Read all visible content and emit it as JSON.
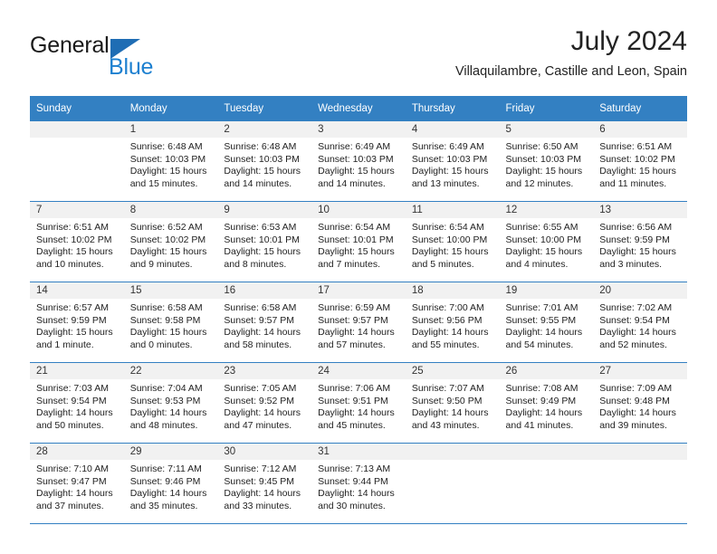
{
  "brand": {
    "name_part1": "General",
    "name_part2": "Blue",
    "triangle_color": "#1f6db4",
    "blue_color": "#1d80d0"
  },
  "header": {
    "title": "July 2024",
    "subtitle": "Villaquilambre, Castille and Leon, Spain"
  },
  "theme": {
    "header_bg": "#3380c2",
    "daynum_bg": "#f1f1f1",
    "grid_line": "#3380c2"
  },
  "weekday_headers": [
    "Sunday",
    "Monday",
    "Tuesday",
    "Wednesday",
    "Thursday",
    "Friday",
    "Saturday"
  ],
  "weeks": [
    [
      {
        "day": "",
        "sunrise": "",
        "sunset": "",
        "daylight_l1": "",
        "daylight_l2": ""
      },
      {
        "day": "1",
        "sunrise": "Sunrise: 6:48 AM",
        "sunset": "Sunset: 10:03 PM",
        "daylight_l1": "Daylight: 15 hours",
        "daylight_l2": "and 15 minutes."
      },
      {
        "day": "2",
        "sunrise": "Sunrise: 6:48 AM",
        "sunset": "Sunset: 10:03 PM",
        "daylight_l1": "Daylight: 15 hours",
        "daylight_l2": "and 14 minutes."
      },
      {
        "day": "3",
        "sunrise": "Sunrise: 6:49 AM",
        "sunset": "Sunset: 10:03 PM",
        "daylight_l1": "Daylight: 15 hours",
        "daylight_l2": "and 14 minutes."
      },
      {
        "day": "4",
        "sunrise": "Sunrise: 6:49 AM",
        "sunset": "Sunset: 10:03 PM",
        "daylight_l1": "Daylight: 15 hours",
        "daylight_l2": "and 13 minutes."
      },
      {
        "day": "5",
        "sunrise": "Sunrise: 6:50 AM",
        "sunset": "Sunset: 10:03 PM",
        "daylight_l1": "Daylight: 15 hours",
        "daylight_l2": "and 12 minutes."
      },
      {
        "day": "6",
        "sunrise": "Sunrise: 6:51 AM",
        "sunset": "Sunset: 10:02 PM",
        "daylight_l1": "Daylight: 15 hours",
        "daylight_l2": "and 11 minutes."
      }
    ],
    [
      {
        "day": "7",
        "sunrise": "Sunrise: 6:51 AM",
        "sunset": "Sunset: 10:02 PM",
        "daylight_l1": "Daylight: 15 hours",
        "daylight_l2": "and 10 minutes."
      },
      {
        "day": "8",
        "sunrise": "Sunrise: 6:52 AM",
        "sunset": "Sunset: 10:02 PM",
        "daylight_l1": "Daylight: 15 hours",
        "daylight_l2": "and 9 minutes."
      },
      {
        "day": "9",
        "sunrise": "Sunrise: 6:53 AM",
        "sunset": "Sunset: 10:01 PM",
        "daylight_l1": "Daylight: 15 hours",
        "daylight_l2": "and 8 minutes."
      },
      {
        "day": "10",
        "sunrise": "Sunrise: 6:54 AM",
        "sunset": "Sunset: 10:01 PM",
        "daylight_l1": "Daylight: 15 hours",
        "daylight_l2": "and 7 minutes."
      },
      {
        "day": "11",
        "sunrise": "Sunrise: 6:54 AM",
        "sunset": "Sunset: 10:00 PM",
        "daylight_l1": "Daylight: 15 hours",
        "daylight_l2": "and 5 minutes."
      },
      {
        "day": "12",
        "sunrise": "Sunrise: 6:55 AM",
        "sunset": "Sunset: 10:00 PM",
        "daylight_l1": "Daylight: 15 hours",
        "daylight_l2": "and 4 minutes."
      },
      {
        "day": "13",
        "sunrise": "Sunrise: 6:56 AM",
        "sunset": "Sunset: 9:59 PM",
        "daylight_l1": "Daylight: 15 hours",
        "daylight_l2": "and 3 minutes."
      }
    ],
    [
      {
        "day": "14",
        "sunrise": "Sunrise: 6:57 AM",
        "sunset": "Sunset: 9:59 PM",
        "daylight_l1": "Daylight: 15 hours",
        "daylight_l2": "and 1 minute."
      },
      {
        "day": "15",
        "sunrise": "Sunrise: 6:58 AM",
        "sunset": "Sunset: 9:58 PM",
        "daylight_l1": "Daylight: 15 hours",
        "daylight_l2": "and 0 minutes."
      },
      {
        "day": "16",
        "sunrise": "Sunrise: 6:58 AM",
        "sunset": "Sunset: 9:57 PM",
        "daylight_l1": "Daylight: 14 hours",
        "daylight_l2": "and 58 minutes."
      },
      {
        "day": "17",
        "sunrise": "Sunrise: 6:59 AM",
        "sunset": "Sunset: 9:57 PM",
        "daylight_l1": "Daylight: 14 hours",
        "daylight_l2": "and 57 minutes."
      },
      {
        "day": "18",
        "sunrise": "Sunrise: 7:00 AM",
        "sunset": "Sunset: 9:56 PM",
        "daylight_l1": "Daylight: 14 hours",
        "daylight_l2": "and 55 minutes."
      },
      {
        "day": "19",
        "sunrise": "Sunrise: 7:01 AM",
        "sunset": "Sunset: 9:55 PM",
        "daylight_l1": "Daylight: 14 hours",
        "daylight_l2": "and 54 minutes."
      },
      {
        "day": "20",
        "sunrise": "Sunrise: 7:02 AM",
        "sunset": "Sunset: 9:54 PM",
        "daylight_l1": "Daylight: 14 hours",
        "daylight_l2": "and 52 minutes."
      }
    ],
    [
      {
        "day": "21",
        "sunrise": "Sunrise: 7:03 AM",
        "sunset": "Sunset: 9:54 PM",
        "daylight_l1": "Daylight: 14 hours",
        "daylight_l2": "and 50 minutes."
      },
      {
        "day": "22",
        "sunrise": "Sunrise: 7:04 AM",
        "sunset": "Sunset: 9:53 PM",
        "daylight_l1": "Daylight: 14 hours",
        "daylight_l2": "and 48 minutes."
      },
      {
        "day": "23",
        "sunrise": "Sunrise: 7:05 AM",
        "sunset": "Sunset: 9:52 PM",
        "daylight_l1": "Daylight: 14 hours",
        "daylight_l2": "and 47 minutes."
      },
      {
        "day": "24",
        "sunrise": "Sunrise: 7:06 AM",
        "sunset": "Sunset: 9:51 PM",
        "daylight_l1": "Daylight: 14 hours",
        "daylight_l2": "and 45 minutes."
      },
      {
        "day": "25",
        "sunrise": "Sunrise: 7:07 AM",
        "sunset": "Sunset: 9:50 PM",
        "daylight_l1": "Daylight: 14 hours",
        "daylight_l2": "and 43 minutes."
      },
      {
        "day": "26",
        "sunrise": "Sunrise: 7:08 AM",
        "sunset": "Sunset: 9:49 PM",
        "daylight_l1": "Daylight: 14 hours",
        "daylight_l2": "and 41 minutes."
      },
      {
        "day": "27",
        "sunrise": "Sunrise: 7:09 AM",
        "sunset": "Sunset: 9:48 PM",
        "daylight_l1": "Daylight: 14 hours",
        "daylight_l2": "and 39 minutes."
      }
    ],
    [
      {
        "day": "28",
        "sunrise": "Sunrise: 7:10 AM",
        "sunset": "Sunset: 9:47 PM",
        "daylight_l1": "Daylight: 14 hours",
        "daylight_l2": "and 37 minutes."
      },
      {
        "day": "29",
        "sunrise": "Sunrise: 7:11 AM",
        "sunset": "Sunset: 9:46 PM",
        "daylight_l1": "Daylight: 14 hours",
        "daylight_l2": "and 35 minutes."
      },
      {
        "day": "30",
        "sunrise": "Sunrise: 7:12 AM",
        "sunset": "Sunset: 9:45 PM",
        "daylight_l1": "Daylight: 14 hours",
        "daylight_l2": "and 33 minutes."
      },
      {
        "day": "31",
        "sunrise": "Sunrise: 7:13 AM",
        "sunset": "Sunset: 9:44 PM",
        "daylight_l1": "Daylight: 14 hours",
        "daylight_l2": "and 30 minutes."
      },
      {
        "day": "",
        "sunrise": "",
        "sunset": "",
        "daylight_l1": "",
        "daylight_l2": ""
      },
      {
        "day": "",
        "sunrise": "",
        "sunset": "",
        "daylight_l1": "",
        "daylight_l2": ""
      },
      {
        "day": "",
        "sunrise": "",
        "sunset": "",
        "daylight_l1": "",
        "daylight_l2": ""
      }
    ]
  ]
}
